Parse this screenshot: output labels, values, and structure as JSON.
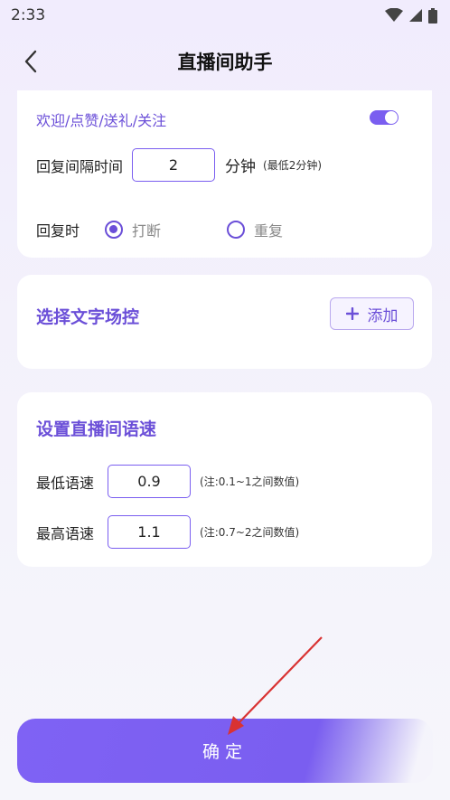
{
  "status": {
    "time": "2:33"
  },
  "header": {
    "title": "直播间助手"
  },
  "reply_card": {
    "event_label": "欢迎/点赞/送礼/关注",
    "interval_label": "回复间隔时间",
    "interval_value": "2",
    "interval_unit": "分钟",
    "interval_hint": "(最低2分钟)",
    "mode_label": "回复时",
    "option_interrupt": "打断",
    "option_repeat": "重复",
    "selected_option": "打断"
  },
  "script_card": {
    "title": "选择文字场控",
    "add_label": "添加"
  },
  "speed_card": {
    "title": "设置直播间语速",
    "min_label": "最低语速",
    "min_value": "0.9",
    "min_hint": "(注:0.1~1之间数值)",
    "max_label": "最高语速",
    "max_value": "1.1",
    "max_hint": "(注:0.7~2之间数值)"
  },
  "footer": {
    "confirm_label": "确定"
  },
  "colors": {
    "accent": "#7a5ef0",
    "title_purple": "#6b4fd8",
    "annotation_arrow": "#d93232"
  }
}
